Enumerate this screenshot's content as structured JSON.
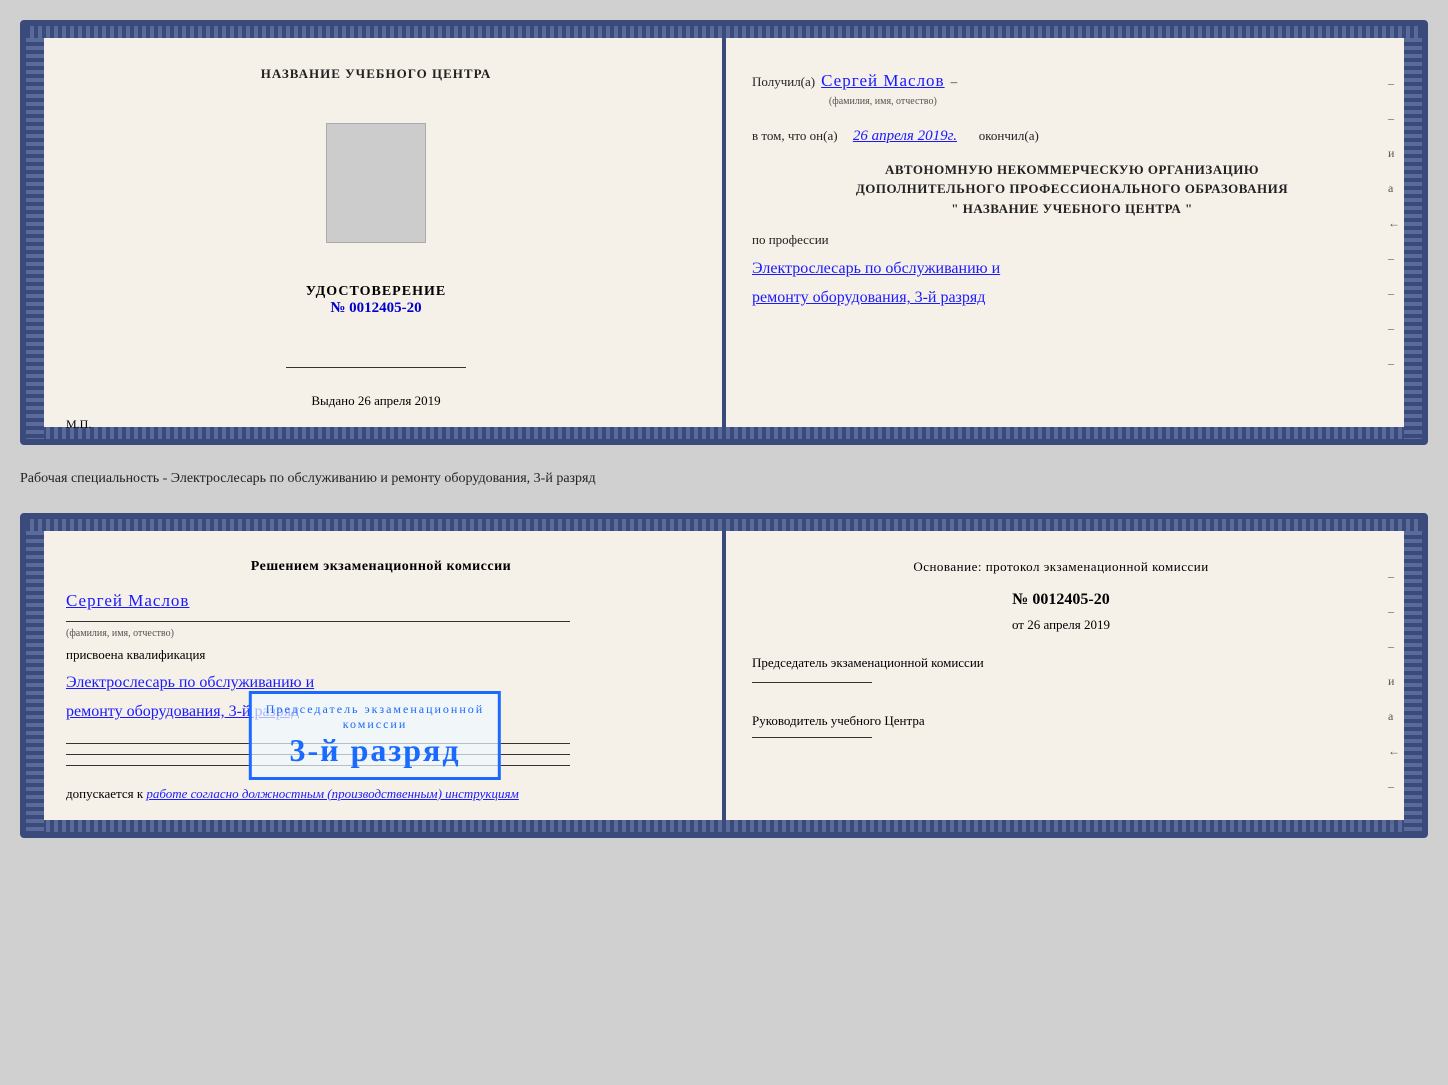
{
  "cert1": {
    "left": {
      "school_name": "НАЗВАНИЕ УЧЕБНОГО ЦЕНТРА",
      "udostoverenie_label": "УДОСТОВЕРЕНИЕ",
      "number_prefix": "№",
      "number": "0012405-20",
      "signature_line": "",
      "vydano_label": "Выдано",
      "vydano_date": "26 апреля 2019",
      "mp_label": "М.П."
    },
    "right": {
      "received_label": "Получил(а)",
      "received_name": "Сергей Маслов",
      "fio_hint": "(фамилия, имя, отчество)",
      "dash": "–",
      "vtom_label": "в том, что он(а)",
      "vtom_date": "26 апреля 2019г.",
      "okончil_label": "окончил(а)",
      "org_line1": "АВТОНОМНУЮ НЕКОММЕРЧЕСКУЮ ОРГАНИЗАЦИЮ",
      "org_line2": "ДОПОЛНИТЕЛЬНОГО ПРОФЕССИОНАЛЬНОГО ОБРАЗОВАНИЯ",
      "org_line3": "\"   НАЗВАНИЕ УЧЕБНОГО ЦЕНТРА   \"",
      "po_professii_label": "по профессии",
      "profession_line1": "Электрослесарь по обслуживанию и",
      "profession_line2": "ремонту оборудования, 3-й разряд"
    }
  },
  "label_between": "Рабочая специальность - Электрослесарь по обслуживанию и ремонту оборудования, 3-й разряд",
  "cert2": {
    "left": {
      "resheniem_title": "Решением экзаменационной комиссии",
      "name": "Сергей Маслов",
      "fio_hint": "(фамилия, имя, отчество)",
      "prisvoena_label": "присвоена квалификация",
      "profession_line1": "Электрослесарь по обслуживанию и",
      "profession_line2": "ремонту оборудования, 3-й разряд",
      "dopuskaetsya_label": "допускается к",
      "dopuskaetsya_text": "работе согласно должностным (производственным) инструкциям"
    },
    "right": {
      "osnovanie_label": "Основание: протокол экзаменационной комиссии",
      "number_prefix": "№",
      "number": "0012405-20",
      "ot_prefix": "от",
      "ot_date": "26 апреля 2019",
      "predsedatel_label": "Председатель экзаменационной комиссии",
      "rukovoditel_label": "Руководитель учебного Центра"
    },
    "stamp": {
      "line1": "3-й разряд"
    }
  }
}
